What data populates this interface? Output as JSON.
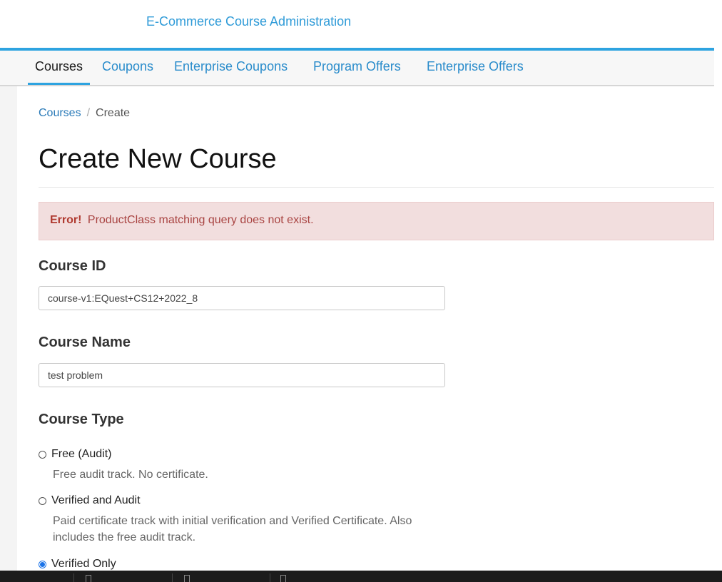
{
  "header": {
    "app_title": "E-Commerce Course Administration",
    "accent_color": "#2ea3e0"
  },
  "nav": {
    "tabs": [
      {
        "label": "Courses",
        "active": true
      },
      {
        "label": "Coupons",
        "active": false
      },
      {
        "label": "Enterprise Coupons",
        "active": false
      },
      {
        "label": "Program Offers",
        "active": false
      },
      {
        "label": "Enterprise Offers",
        "active": false
      }
    ]
  },
  "breadcrumb": {
    "parent": "Courses",
    "separator": "/",
    "current": "Create"
  },
  "page": {
    "title": "Create New Course"
  },
  "alert": {
    "prefix": "Error!",
    "message": "ProductClass matching query does not exist.",
    "bg_color": "#f2dede",
    "text_color": "#a94442"
  },
  "form": {
    "course_id": {
      "label": "Course ID",
      "value": "course-v1:EQuest+CS12+2022_8"
    },
    "course_name": {
      "label": "Course Name",
      "value": "test problem"
    },
    "course_type": {
      "label": "Course Type",
      "options": [
        {
          "label": "Free (Audit)",
          "description": "Free audit track. No certificate.",
          "selected": false
        },
        {
          "label": "Verified and Audit",
          "description": "Paid certificate track with initial verification and Verified Certificate. Also includes the free audit track.",
          "selected": false
        },
        {
          "label": "Verified Only",
          "description": "",
          "selected": true
        }
      ]
    }
  }
}
